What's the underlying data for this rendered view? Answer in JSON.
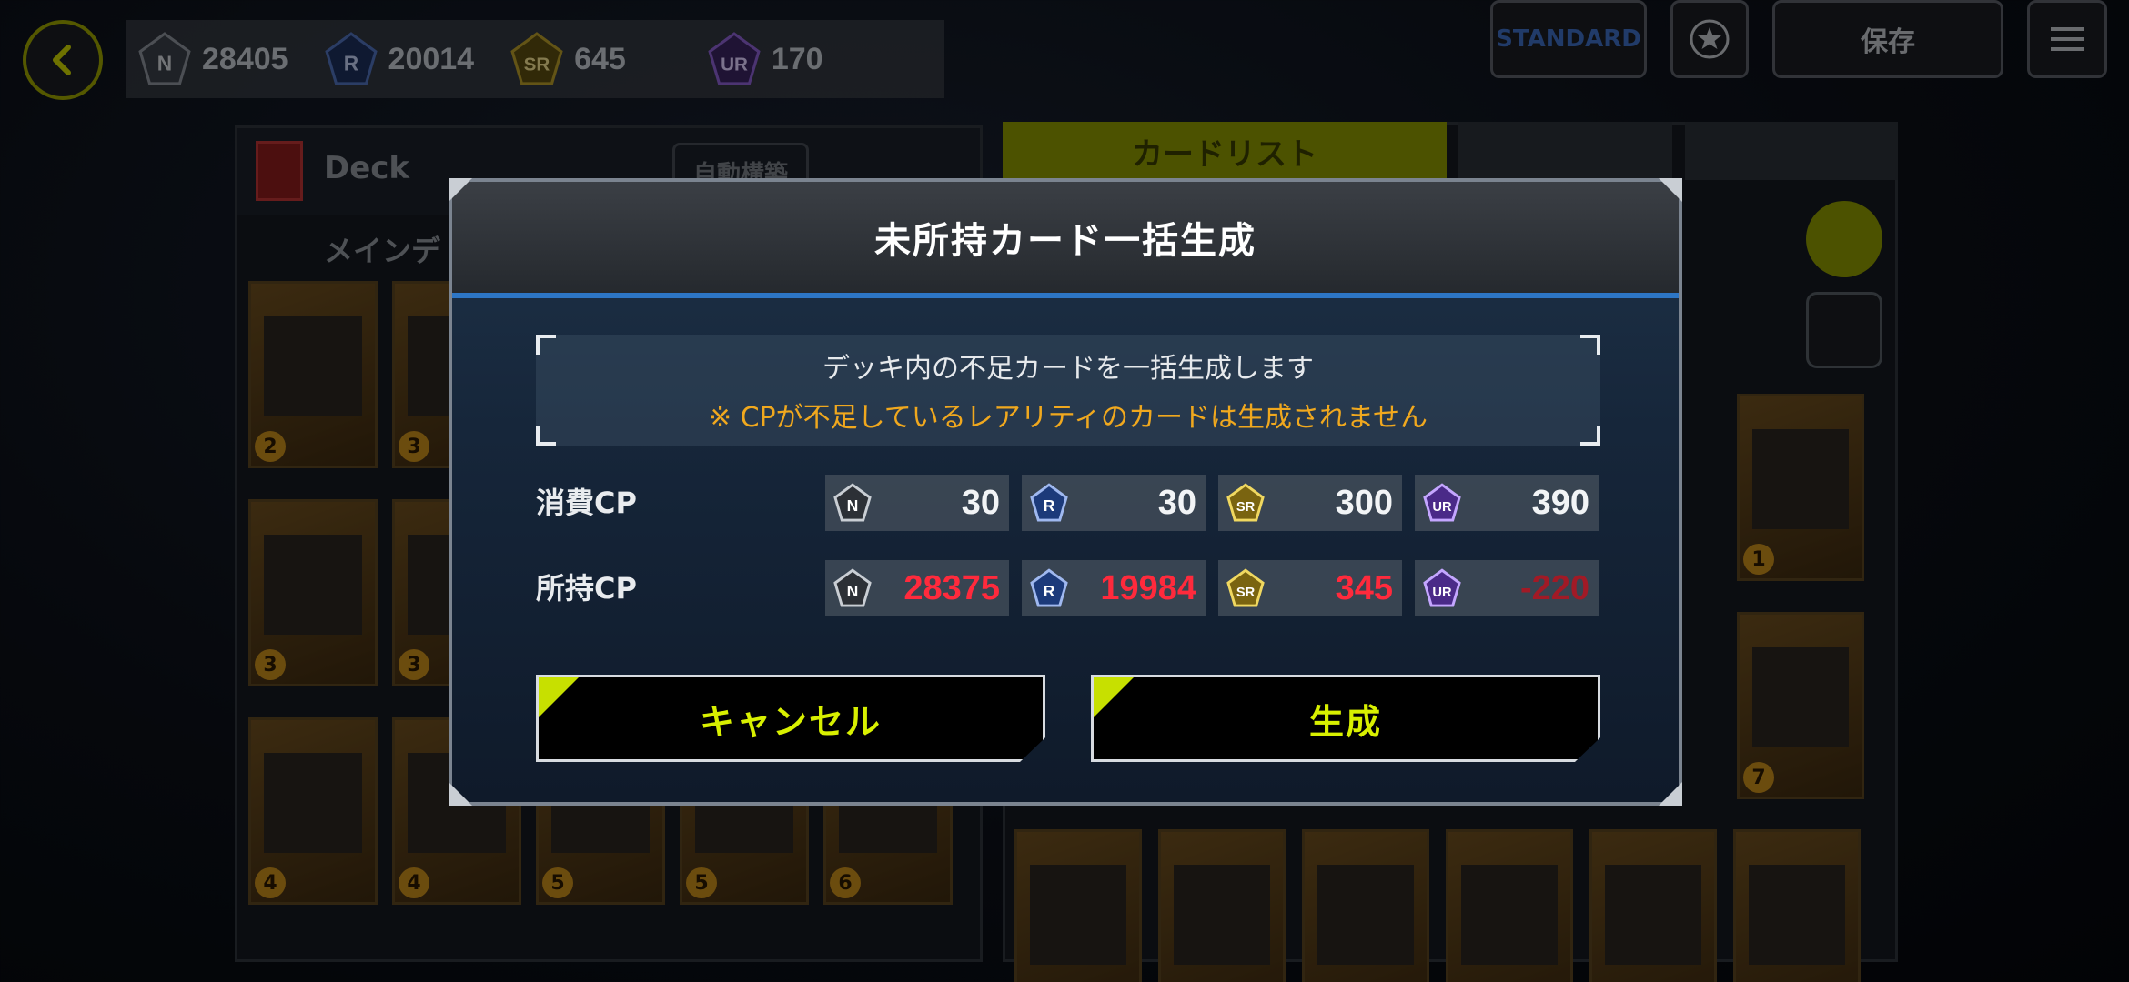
{
  "topbar": {
    "cp": [
      {
        "rarity": "N",
        "value": "28405",
        "color": "#6f7580"
      },
      {
        "rarity": "R",
        "value": "20014",
        "color": "#3c5fa8"
      },
      {
        "rarity": "SR",
        "value": "645",
        "color": "#a08a20"
      },
      {
        "rarity": "UR",
        "value": "170",
        "color": "#6a3fa8"
      }
    ],
    "format_label": "STANDARD",
    "save_label": "保存"
  },
  "deck_panel": {
    "title": "Deck",
    "auto_label": "自動構築",
    "section_label": "メインデ"
  },
  "card_list": {
    "tab_label": "カードリスト"
  },
  "modal": {
    "title": "未所持カード一括生成",
    "info_line1": "デッキ内の不足カードを一括生成します",
    "info_line2": "※ CPが不足しているレアリティのカードは生成されません",
    "consume_label": "消費CP",
    "owned_label": "所持CP",
    "consume": [
      {
        "rarity": "N",
        "value": "30"
      },
      {
        "rarity": "R",
        "value": "30"
      },
      {
        "rarity": "SR",
        "value": "300"
      },
      {
        "rarity": "UR",
        "value": "390"
      }
    ],
    "owned": [
      {
        "rarity": "N",
        "value": "28375"
      },
      {
        "rarity": "R",
        "value": "19984"
      },
      {
        "rarity": "SR",
        "value": "345"
      },
      {
        "rarity": "UR",
        "value": "-220"
      }
    ],
    "cancel_label": "キャンセル",
    "generate_label": "生成"
  },
  "colors": {
    "accent_lime": "#d8f000",
    "header_blue": "#2d76c5",
    "warning_orange": "#f0a81e",
    "owned_red": "#ff2a3c"
  }
}
